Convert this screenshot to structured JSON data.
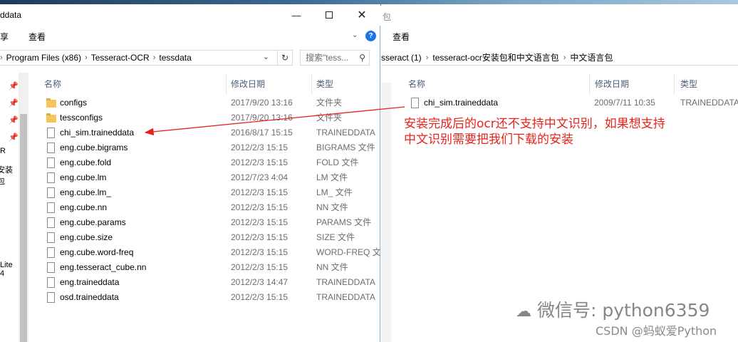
{
  "left_window": {
    "title": "ddata",
    "ribbon": {
      "share": "享",
      "view": "查看"
    },
    "address": {
      "segments": [
        "Program Files (x86)",
        "Tesseract-OCR",
        "tessdata"
      ]
    },
    "search_placeholder": "搜索\"tess...",
    "columns": {
      "name": "名称",
      "date": "修改日期",
      "type": "类型"
    },
    "nav_labels": [
      "R",
      "安装包",
      "Lite 4"
    ],
    "files": [
      {
        "name": "configs",
        "date": "2017/9/20 13:16",
        "type": "文件夹",
        "kind": "folder"
      },
      {
        "name": "tessconfigs",
        "date": "2017/9/20 13:16",
        "type": "文件夹",
        "kind": "folder"
      },
      {
        "name": "chi_sim.traineddata",
        "date": "2016/8/17 15:15",
        "type": "TRAINEDDATA",
        "kind": "file"
      },
      {
        "name": "eng.cube.bigrams",
        "date": "2012/2/3 15:15",
        "type": "BIGRAMS 文件",
        "kind": "file"
      },
      {
        "name": "eng.cube.fold",
        "date": "2012/2/3 15:15",
        "type": "FOLD 文件",
        "kind": "file"
      },
      {
        "name": "eng.cube.lm",
        "date": "2012/7/23 4:04",
        "type": "LM 文件",
        "kind": "file"
      },
      {
        "name": "eng.cube.lm_",
        "date": "2012/2/3 15:15",
        "type": "LM_ 文件",
        "kind": "file"
      },
      {
        "name": "eng.cube.nn",
        "date": "2012/2/3 15:15",
        "type": "NN 文件",
        "kind": "file"
      },
      {
        "name": "eng.cube.params",
        "date": "2012/2/3 15:15",
        "type": "PARAMS 文件",
        "kind": "file"
      },
      {
        "name": "eng.cube.size",
        "date": "2012/2/3 15:15",
        "type": "SIZE 文件",
        "kind": "file"
      },
      {
        "name": "eng.cube.word-freq",
        "date": "2012/2/3 15:15",
        "type": "WORD-FREQ 文",
        "kind": "file"
      },
      {
        "name": "eng.tesseract_cube.nn",
        "date": "2012/2/3 15:15",
        "type": "NN 文件",
        "kind": "file"
      },
      {
        "name": "eng.traineddata",
        "date": "2012/2/3 14:47",
        "type": "TRAINEDDATA",
        "kind": "file"
      },
      {
        "name": "osd.traineddata",
        "date": "2012/2/3 15:15",
        "type": "TRAINEDDATA",
        "kind": "file"
      }
    ]
  },
  "right_window": {
    "title_fragment": "包",
    "ribbon": {
      "view": "查看"
    },
    "address": {
      "segments": [
        "sseract (1)",
        "tesseract-ocr安装包和中文语言包",
        "中文语言包"
      ]
    },
    "columns": {
      "name": "名称",
      "date": "修改日期",
      "type": "类型"
    },
    "files": [
      {
        "name": "chi_sim.traineddata",
        "date": "2009/7/11 10:35",
        "type": "TRAINEDDATA",
        "kind": "file"
      }
    ]
  },
  "annotation": {
    "text": "安装完成后的ocr还不支持中文识别，如果想支持中文识别需要把我们下载的安装",
    "color": "#e8231d"
  },
  "watermark": {
    "wechat": "微信号: python6359",
    "csdn": "CSDN @蚂蚁爱Python"
  }
}
